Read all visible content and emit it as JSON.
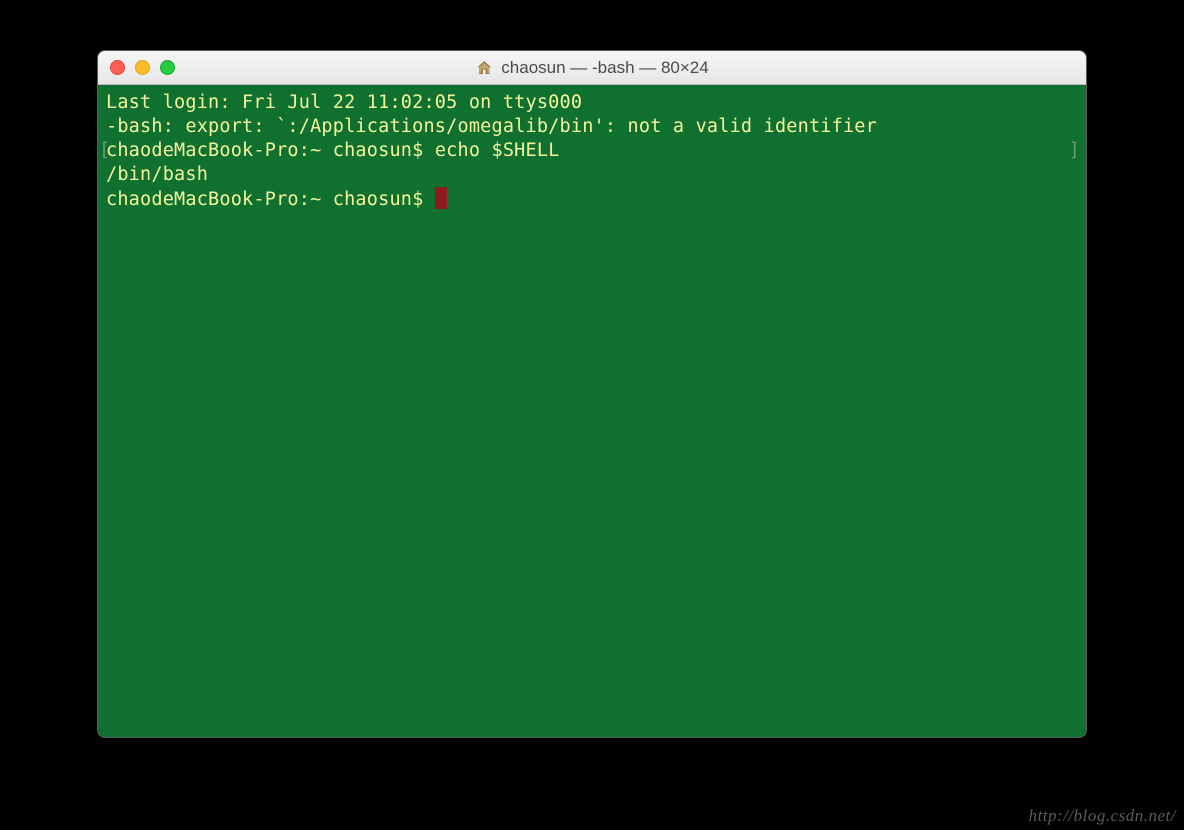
{
  "window": {
    "title": "chaosun — -bash — 80×24"
  },
  "terminal": {
    "lines": {
      "l1": "Last login: Fri Jul 22 11:02:05 on ttys000",
      "l2": "-bash: export: `:/Applications/omegalib/bin': not a valid identifier",
      "l3_prompt": "chaodeMacBook-Pro:~ chaosun$ ",
      "l3_cmd": "echo $SHELL",
      "l4": "/bin/bash",
      "l5_prompt": "chaodeMacBook-Pro:~ chaosun$ "
    },
    "bracket_left": "[",
    "bracket_right": "]"
  },
  "watermark": "http://blog.csdn.net/"
}
